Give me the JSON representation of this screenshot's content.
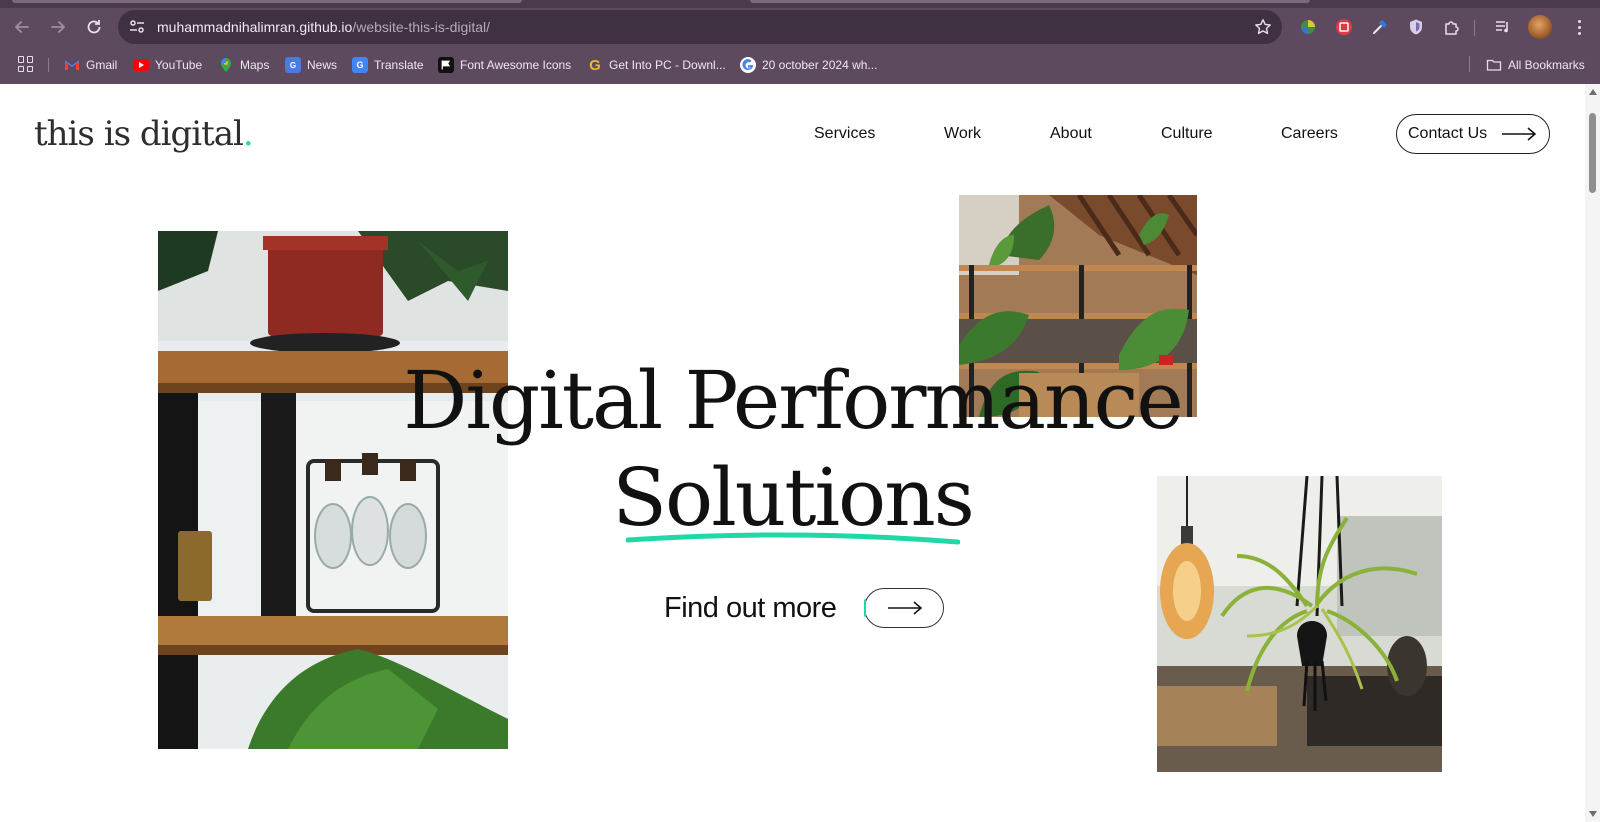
{
  "browser": {
    "url_host": "muhammadnihalimran.github.io",
    "url_path": "/website-this-is-digital/",
    "bookmarks": [
      {
        "label": "Gmail",
        "icon": "gmail-icon"
      },
      {
        "label": "YouTube",
        "icon": "youtube-icon"
      },
      {
        "label": "Maps",
        "icon": "maps-icon"
      },
      {
        "label": "News",
        "icon": "news-icon"
      },
      {
        "label": "Translate",
        "icon": "translate-icon"
      },
      {
        "label": "Font Awesome Icons",
        "icon": "font-awesome-icon"
      },
      {
        "label": "Get Into PC - Downl...",
        "icon": "get-into-pc-icon"
      },
      {
        "label": "20 october 2024 wh...",
        "icon": "google-icon"
      }
    ],
    "all_bookmarks_label": "All Bookmarks"
  },
  "site": {
    "logo_text": "this is digital",
    "logo_dot": ".",
    "nav": [
      "Services",
      "Work",
      "About",
      "Culture",
      "Careers"
    ],
    "contact_label": "Contact Us",
    "headline_line1": "Digital Performance",
    "headline_line2": "Solutions",
    "cta_label": "Find out more"
  },
  "colors": {
    "accent": "#1fd8a6",
    "chrome": "#5d4a5e",
    "omnibox": "#3f3141"
  }
}
